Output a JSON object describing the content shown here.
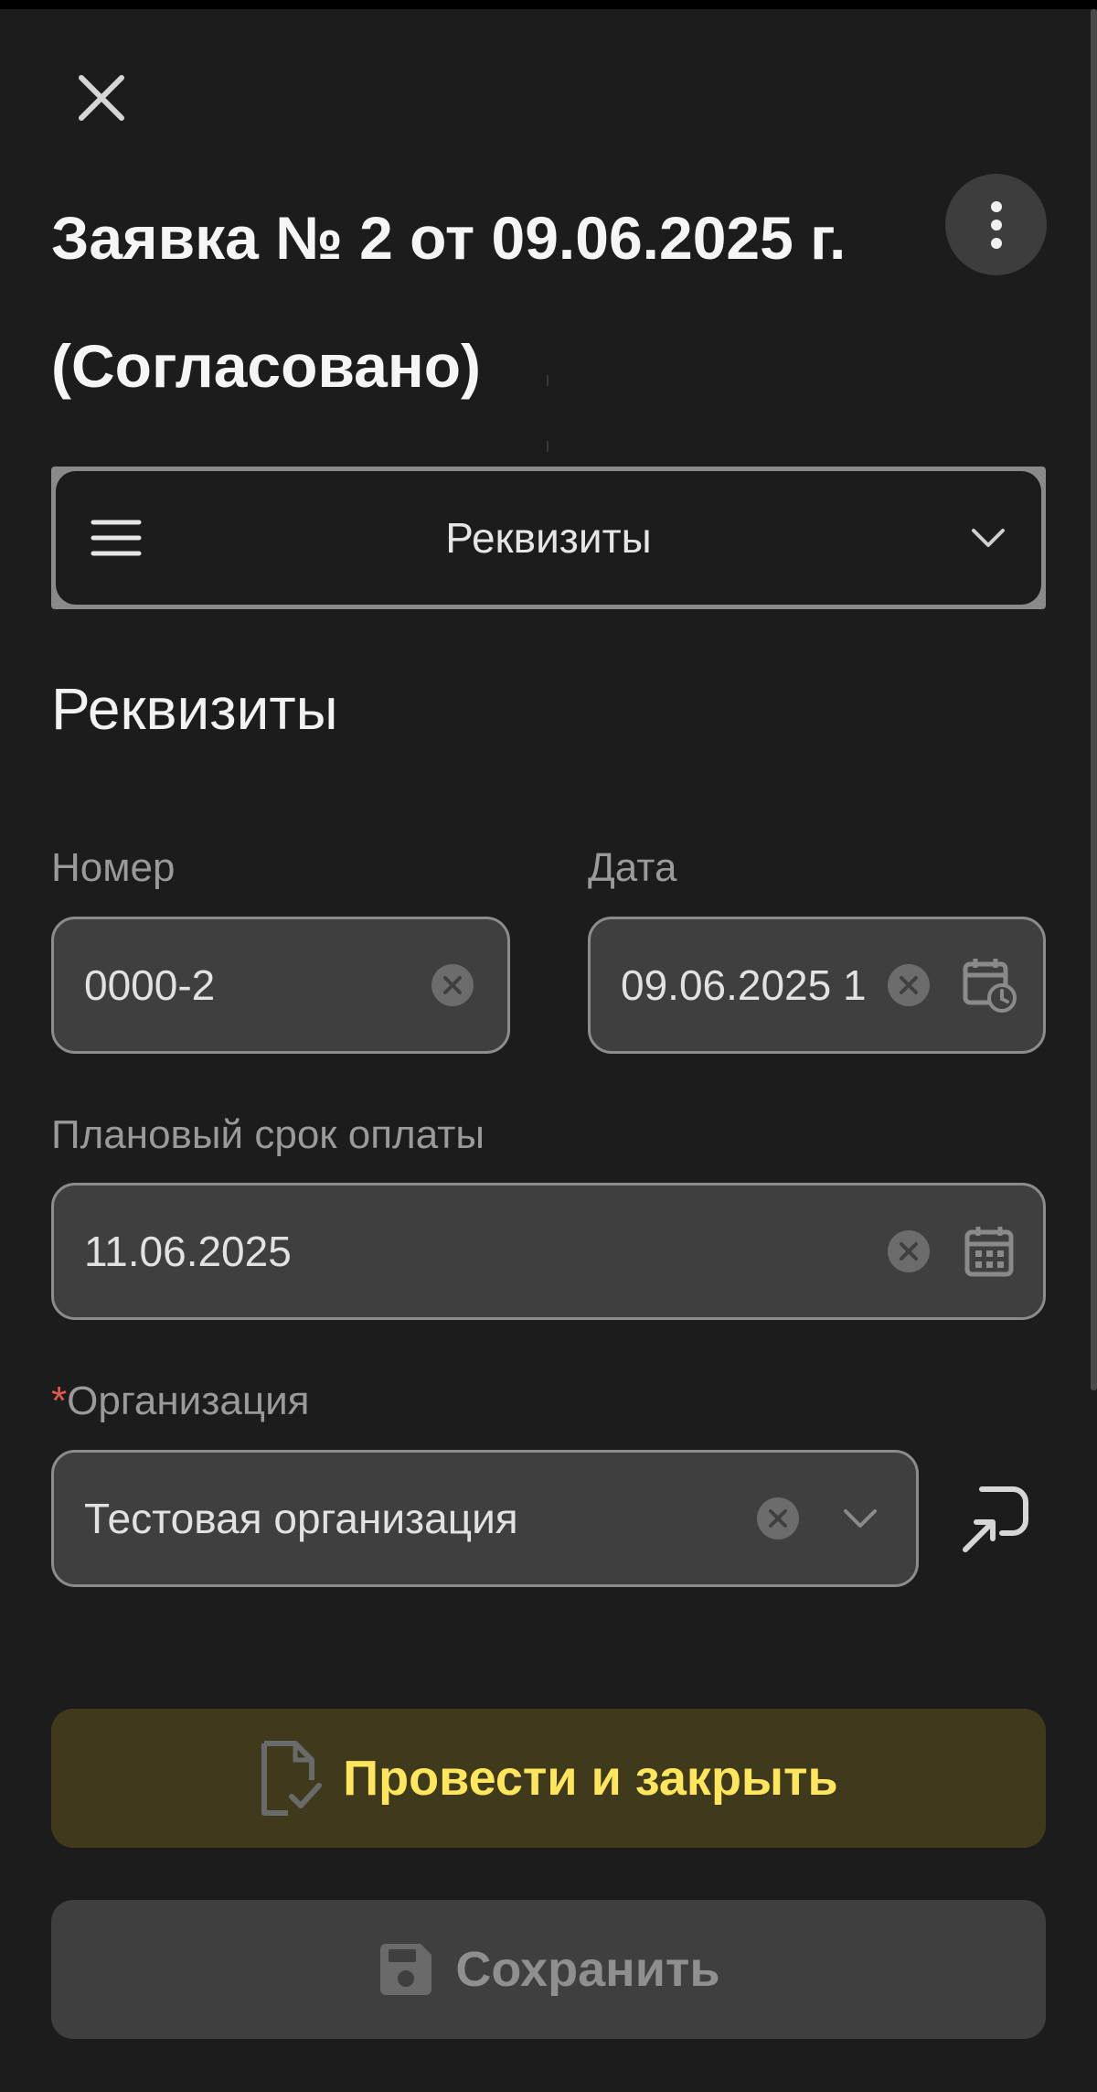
{
  "header": {
    "title_line1": "Заявка № 2 от 09.06.2025 г.",
    "title_line2": "(Согласовано)"
  },
  "icons": {
    "close": "close-icon",
    "more": "more-vertical-icon",
    "menu": "menu-icon",
    "chevron": "chevron-down-icon",
    "clear": "clear-circle-icon",
    "calendar": "calendar-icon",
    "calendar_clock": "calendar-clock-icon",
    "open_link": "open-external-icon",
    "document_check": "document-check-icon",
    "save": "floppy-disk-icon"
  },
  "section_select": {
    "label": "Реквизиты"
  },
  "section": {
    "heading": "Реквизиты"
  },
  "fields": {
    "number": {
      "label": "Номер",
      "value": "0000-2"
    },
    "date": {
      "label": "Дата",
      "value": "09.06.2025 1"
    },
    "payment_due": {
      "label": "Плановый срок оплаты",
      "value": "11.06.2025"
    },
    "organization": {
      "required_mark": "*",
      "label": "Организация",
      "value": "Тестовая организация"
    }
  },
  "actions": {
    "post_close_label": "Провести и закрыть",
    "save_label": "Сохранить"
  },
  "colors": {
    "background": "#1c1c1c",
    "field_bg": "#3f3f3f",
    "field_border": "#8c8c8c",
    "primary_button_bg": "#3f3a1c",
    "primary_button_text": "#ffe65c",
    "required": "#e05a4d"
  }
}
